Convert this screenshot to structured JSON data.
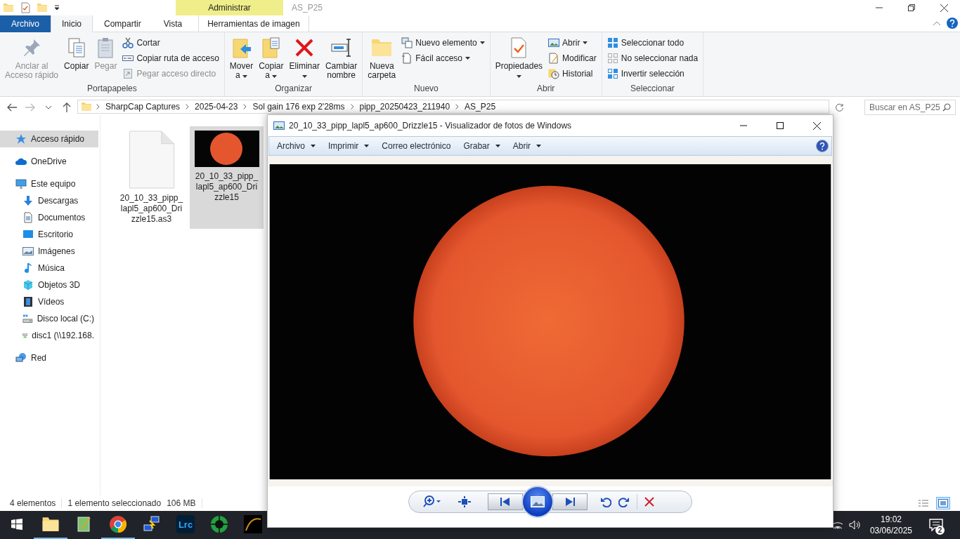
{
  "title_bar": {
    "title": "AS_P25",
    "contextual_group": "Administrar"
  },
  "tabs": [
    {
      "label": "Archivo",
      "kind": "file",
      "selected": false
    },
    {
      "label": "Inicio",
      "kind": "tab",
      "selected": true
    },
    {
      "label": "Compartir",
      "kind": "tab",
      "selected": false
    },
    {
      "label": "Vista",
      "kind": "tab",
      "selected": false
    },
    {
      "label": "Herramientas de imagen",
      "kind": "contextual",
      "selected": false
    }
  ],
  "ribbon": [
    {
      "name": "Portapapeles",
      "commands": [
        {
          "kind": "large",
          "lines": [
            "Anclar al",
            "Acceso rápido"
          ],
          "disabled": true,
          "dropdown": false
        },
        {
          "kind": "large",
          "lines": [
            "Copiar"
          ],
          "disabled": false,
          "dropdown": false
        },
        {
          "kind": "large",
          "lines": [
            "Pegar"
          ],
          "disabled": true,
          "dropdown": false
        },
        {
          "kind": "small",
          "lines": [
            "Cortar"
          ],
          "disabled": false,
          "dropdown": false
        },
        {
          "kind": "small",
          "lines": [
            "Copiar ruta de acceso"
          ],
          "disabled": false,
          "dropdown": false
        },
        {
          "kind": "small",
          "lines": [
            "Pegar acceso directo"
          ],
          "disabled": true,
          "dropdown": false
        }
      ]
    },
    {
      "name": "Organizar",
      "commands": [
        {
          "kind": "large",
          "lines": [
            "Mover",
            "a"
          ],
          "disabled": false,
          "dropdown": true
        },
        {
          "kind": "large",
          "lines": [
            "Copiar",
            "a"
          ],
          "disabled": false,
          "dropdown": true
        },
        {
          "kind": "large",
          "lines": [
            "Eliminar"
          ],
          "disabled": false,
          "dropdown": true
        },
        {
          "kind": "large",
          "lines": [
            "Cambiar",
            "nombre"
          ],
          "disabled": false,
          "dropdown": false
        }
      ]
    },
    {
      "name": "Nuevo",
      "commands": [
        {
          "kind": "large",
          "lines": [
            "Nueva",
            "carpeta"
          ],
          "disabled": false,
          "dropdown": false
        },
        {
          "kind": "small",
          "lines": [
            "Nuevo elemento"
          ],
          "disabled": false,
          "dropdown": true
        },
        {
          "kind": "small",
          "lines": [
            "Fácil acceso"
          ],
          "disabled": false,
          "dropdown": true
        }
      ]
    },
    {
      "name": "Abrir",
      "commands": [
        {
          "kind": "large",
          "lines": [
            "Propiedades"
          ],
          "disabled": false,
          "dropdown": true
        },
        {
          "kind": "small",
          "lines": [
            "Abrir"
          ],
          "disabled": false,
          "dropdown": true
        },
        {
          "kind": "small",
          "lines": [
            "Modificar"
          ],
          "disabled": false,
          "dropdown": false
        },
        {
          "kind": "small",
          "lines": [
            "Historial"
          ],
          "disabled": false,
          "dropdown": false
        }
      ]
    },
    {
      "name": "Seleccionar",
      "commands": [
        {
          "kind": "small",
          "lines": [
            "Seleccionar todo"
          ],
          "disabled": false,
          "dropdown": false
        },
        {
          "kind": "small",
          "lines": [
            "No seleccionar nada"
          ],
          "disabled": false,
          "dropdown": false
        },
        {
          "kind": "small",
          "lines": [
            "Invertir selección"
          ],
          "disabled": false,
          "dropdown": false
        }
      ]
    }
  ],
  "address_bar": {
    "breadcrumbs": [
      "SharpCap Captures",
      "2025-04-23",
      "Sol gain 176 exp 2'28ms",
      "pipp_20250423_211940",
      "AS_P25"
    ],
    "search_placeholder": "Buscar en AS_P25"
  },
  "sidebar": {
    "items": [
      {
        "label": "Acceso rápido",
        "selected": true
      },
      {
        "label": "OneDrive",
        "selected": false
      },
      {
        "label": "Este equipo",
        "selected": false,
        "children": [
          {
            "label": "Descargas",
            "selected": false
          },
          {
            "label": "Documentos",
            "selected": false
          },
          {
            "label": "Escritorio",
            "selected": false
          },
          {
            "label": "Imágenes",
            "selected": false
          },
          {
            "label": "Música",
            "selected": false
          },
          {
            "label": "Objetos 3D",
            "selected": false
          },
          {
            "label": "Vídeos",
            "selected": false
          },
          {
            "label": "Disco local (C:)",
            "selected": false
          },
          {
            "label": "disc1 (\\\\192.168.",
            "selected": false
          }
        ]
      },
      {
        "label": "Red",
        "selected": false
      }
    ]
  },
  "files": [
    {
      "kind": "document",
      "name": "20_10_33_pipp_lapl5_ap600_Drizzle15.as3",
      "selected": false
    },
    {
      "kind": "image",
      "name": "20_10_33_pipp_lapl5_ap600_Drizzle15",
      "selected": true
    }
  ],
  "status_bar": {
    "count": "4 elementos",
    "selection": "1 elemento seleccionado",
    "size": "106 MB",
    "views": [
      {
        "kind": "details",
        "selected": false
      },
      {
        "kind": "large-icons",
        "selected": true
      }
    ]
  },
  "viewer": {
    "title": "20_10_33_pipp_lapl5_ap600_Drizzle15 - Visualizador de fotos de Windows",
    "menu": [
      {
        "label": "Archivo",
        "dropdown": true
      },
      {
        "label": "Imprimir",
        "dropdown": true
      },
      {
        "label": "Correo electrónico",
        "dropdown": false
      },
      {
        "label": "Grabar",
        "dropdown": true
      },
      {
        "label": "Abrir",
        "dropdown": true
      }
    ]
  },
  "taskbar": {
    "apps": [
      {
        "kind": "explorer",
        "running": true
      },
      {
        "kind": "notepad",
        "running": false
      },
      {
        "kind": "chrome",
        "running": true
      },
      {
        "kind": "network",
        "running": false
      },
      {
        "kind": "lightroom",
        "label": "Lrc",
        "running": false
      },
      {
        "kind": "green",
        "running": false
      },
      {
        "kind": "dark",
        "running": false
      }
    ],
    "clock": "19:02",
    "date": "03/06/2025",
    "notifications": "2"
  }
}
